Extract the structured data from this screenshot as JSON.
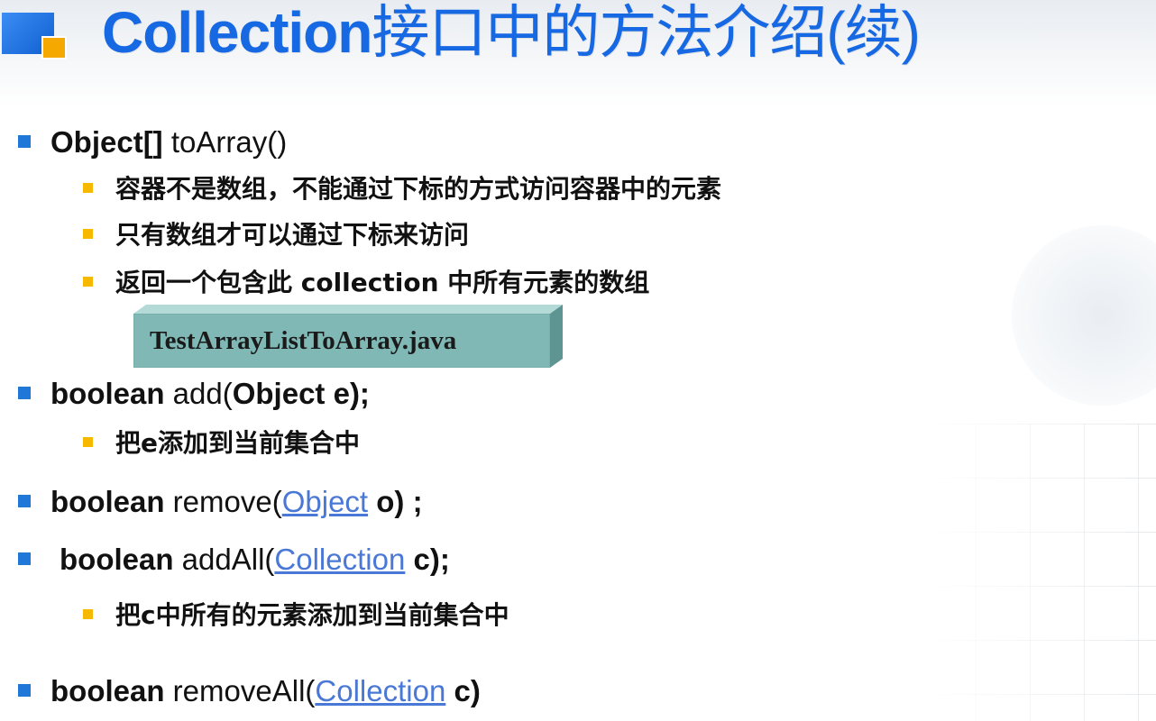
{
  "title": {
    "latin": "Collection",
    "cjk": "接口中的方法介绍(续)"
  },
  "items": {
    "toArray": {
      "type": "Object[]",
      "method": " toArray()",
      "subs": [
        "容器不是数组，不能通过下标的方式访问容器中的元素",
        "只有数组才可以通过下标来访问",
        "返回一个包含此 collection 中所有元素的数组"
      ],
      "file": "TestArrayListToArray.java"
    },
    "add": {
      "kw": "boolean",
      "name": " add(",
      "param": "Object e);",
      "sub": "把e添加到当前集合中"
    },
    "remove": {
      "kw": "boolean",
      "name": " remove(",
      "link": "Object",
      "tail": " o) ;"
    },
    "addAll": {
      "kw": "boolean",
      "name": " addAll(",
      "link": "Collection",
      "tail": " c);",
      "sub": "把c中所有的元素添加到当前集合中"
    },
    "removeAll": {
      "kw": "boolean",
      "name": " removeAll(",
      "link": "Collection",
      "tail": " c)"
    }
  },
  "colors": {
    "title": "#1668e3",
    "bullet_level1": "#1f78d8",
    "bullet_level2": "#f6b800",
    "link": "#4a78d6",
    "file_box": "#7fb8b4"
  }
}
